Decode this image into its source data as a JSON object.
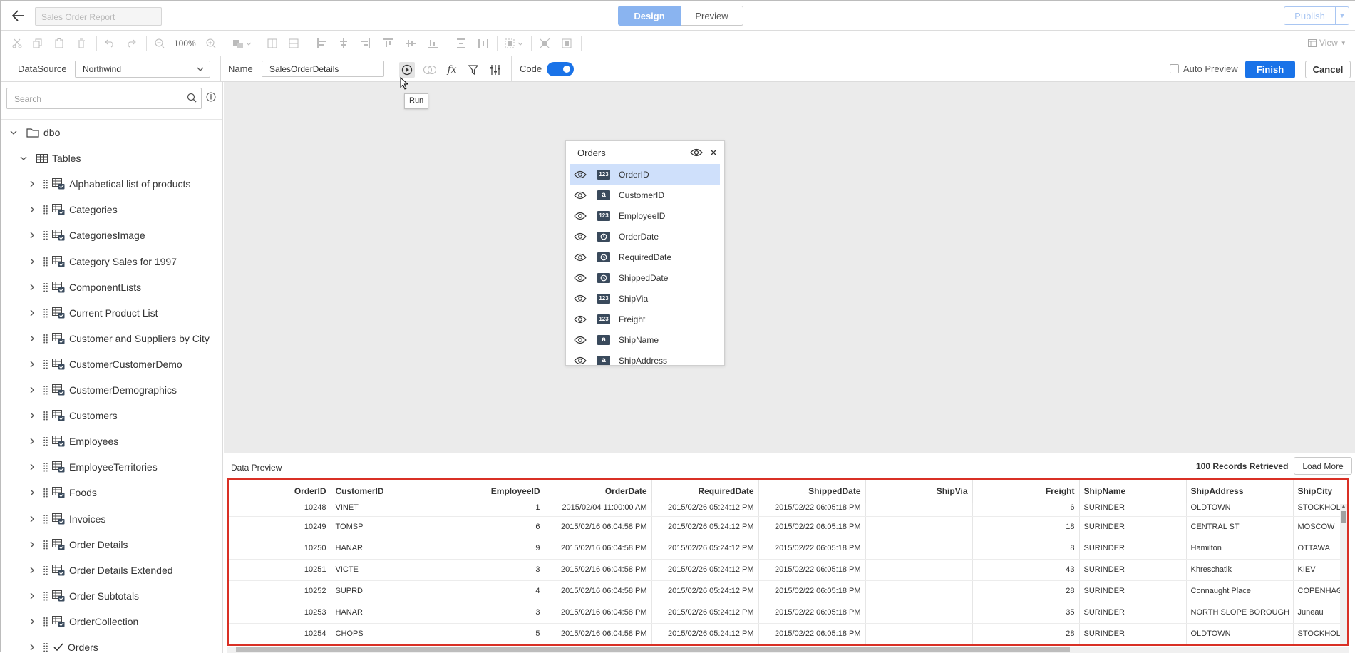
{
  "header": {
    "report_title_placeholder": "Sales Order Report",
    "tabs": [
      {
        "label": "Design",
        "active": true
      },
      {
        "label": "Preview",
        "active": false
      }
    ],
    "publish_label": "Publish"
  },
  "toolbar": {
    "zoom": "100%",
    "view_label": "View"
  },
  "querybar": {
    "datasource_label": "DataSource",
    "datasource_value": "Northwind",
    "name_label": "Name",
    "name_value": "SalesOrderDetails",
    "code_label": "Code",
    "code_enabled": true,
    "auto_preview_label": "Auto Preview",
    "finish_label": "Finish",
    "cancel_label": "Cancel",
    "tooltip": "Run"
  },
  "sidebar": {
    "search_placeholder": "Search",
    "root": "dbo",
    "tables_label": "Tables",
    "tables": [
      "Alphabetical list of products",
      "Categories",
      "CategoriesImage",
      "Category Sales for 1997",
      "ComponentLists",
      "Current Product List",
      "Customer and Suppliers by City",
      "CustomerCustomerDemo",
      "CustomerDemographics",
      "Customers",
      "Employees",
      "EmployeeTerritories",
      "Foods",
      "Invoices",
      "Order Details",
      "Order Details Extended",
      "Order Subtotals",
      "OrderCollection",
      "Orders"
    ]
  },
  "orders_card": {
    "title": "Orders",
    "fields": [
      {
        "name": "OrderID",
        "type": "123",
        "selected": true
      },
      {
        "name": "CustomerID",
        "type": "a",
        "selected": false
      },
      {
        "name": "EmployeeID",
        "type": "123",
        "selected": false
      },
      {
        "name": "OrderDate",
        "type": "clock",
        "selected": false
      },
      {
        "name": "RequiredDate",
        "type": "clock",
        "selected": false
      },
      {
        "name": "ShippedDate",
        "type": "clock",
        "selected": false
      },
      {
        "name": "ShipVia",
        "type": "123",
        "selected": false
      },
      {
        "name": "Freight",
        "type": "123",
        "selected": false
      },
      {
        "name": "ShipName",
        "type": "a",
        "selected": false
      },
      {
        "name": "ShipAddress",
        "type": "a",
        "selected": false
      }
    ]
  },
  "preview": {
    "title": "Data Preview",
    "records": "100 Records Retrieved",
    "load_more": "Load More",
    "columns": [
      "OrderID",
      "CustomerID",
      "EmployeeID",
      "OrderDate",
      "RequiredDate",
      "ShippedDate",
      "ShipVia",
      "Freight",
      "ShipName",
      "ShipAddress",
      "ShipCity"
    ],
    "rows": [
      [
        "10248",
        "VINET",
        "1",
        "2015/02/04 11:00:00 AM",
        "2015/02/26 05:24:12 PM",
        "2015/02/22 06:05:18 PM",
        "",
        "6",
        "SURINDER",
        "OLDTOWN",
        "STOCKHOLM"
      ],
      [
        "10249",
        "TOMSP",
        "6",
        "2015/02/16 06:04:58 PM",
        "2015/02/26 05:24:12 PM",
        "2015/02/22 06:05:18 PM",
        "",
        "18",
        "SURINDER",
        "CENTRAL ST",
        "MOSCOW"
      ],
      [
        "10250",
        "HANAR",
        "9",
        "2015/02/16 06:04:58 PM",
        "2015/02/26 05:24:12 PM",
        "2015/02/22 06:05:18 PM",
        "",
        "8",
        "SURINDER",
        "Hamilton",
        "OTTAWA"
      ],
      [
        "10251",
        "VICTE",
        "3",
        "2015/02/16 06:04:58 PM",
        "2015/02/26 05:24:12 PM",
        "2015/02/22 06:05:18 PM",
        "",
        "43",
        "SURINDER",
        "Khreschatik",
        "KIEV"
      ],
      [
        "10252",
        "SUPRD",
        "4",
        "2015/02/16 06:04:58 PM",
        "2015/02/26 05:24:12 PM",
        "2015/02/22 06:05:18 PM",
        "",
        "28",
        "SURINDER",
        "Connaught Place",
        "COPENHAGEN"
      ],
      [
        "10253",
        "HANAR",
        "3",
        "2015/02/16 06:04:58 PM",
        "2015/02/26 05:24:12 PM",
        "2015/02/22 06:05:18 PM",
        "",
        "35",
        "SURINDER",
        "NORTH SLOPE BOROUGH",
        "Juneau"
      ],
      [
        "10254",
        "CHOPS",
        "5",
        "2015/02/16 06:04:58 PM",
        "2015/02/26 05:24:12 PM",
        "2015/02/22 06:05:18 PM",
        "",
        "28",
        "SURINDER",
        "OLDTOWN",
        "STOCKHOLM"
      ]
    ]
  },
  "colors": {
    "accent": "#1a73e8",
    "design_tab": "#8ab4f0",
    "selection": "#cfe0fb",
    "highlight_border": "#d93025",
    "canvas_bg": "#ebebeb"
  }
}
